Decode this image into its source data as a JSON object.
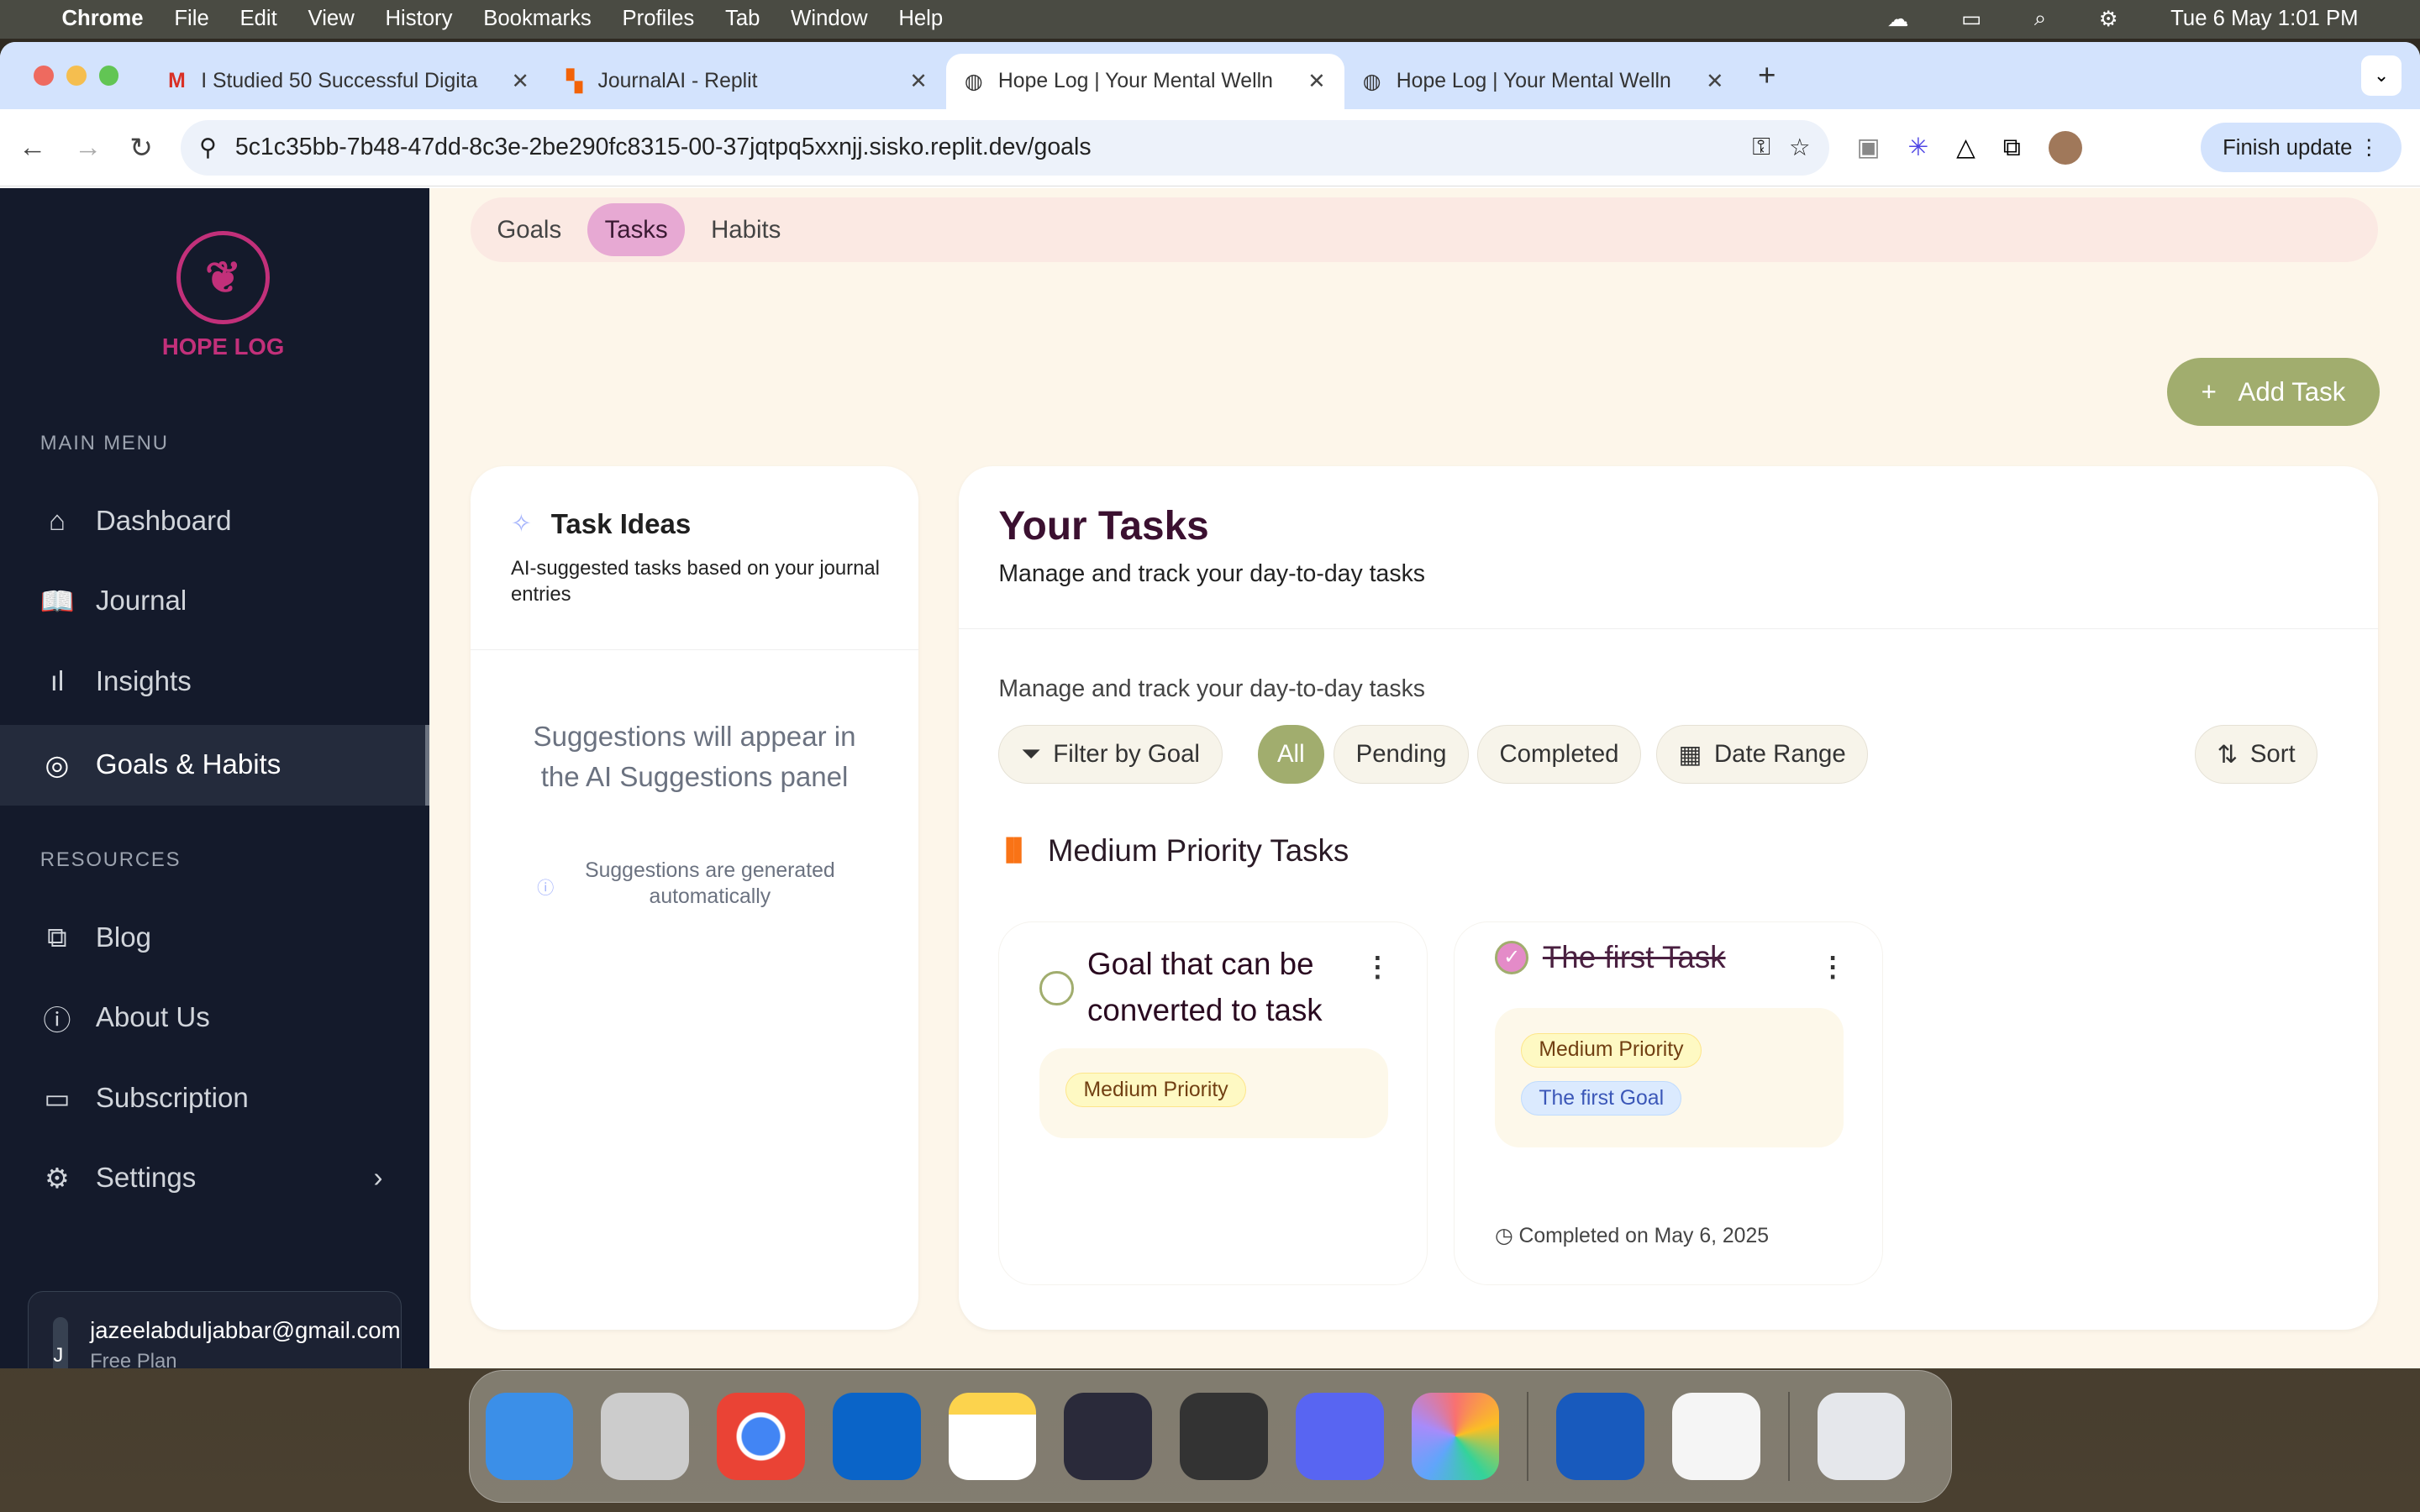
{
  "menubar": {
    "app": "Chrome",
    "items": [
      "File",
      "Edit",
      "View",
      "History",
      "Bookmarks",
      "Profiles",
      "Tab",
      "Window",
      "Help"
    ],
    "datetime": "Tue 6 May  1:01 PM"
  },
  "browser": {
    "tabs": [
      {
        "title": "I Studied 50 Successful Digita",
        "icon": "gmail-icon"
      },
      {
        "title": "JournalAI - Replit",
        "icon": "replit-icon"
      },
      {
        "title": "Hope Log | Your Mental Welln",
        "icon": "globe-icon",
        "active": true
      },
      {
        "title": "Hope Log | Your Mental Welln",
        "icon": "globe-icon"
      }
    ],
    "url": "5c1c35bb-7b48-47dd-8c3e-2be290fc8315-00-37jqtpq5xxnjj.sisko.replit.dev/goals",
    "finish_update": "Finish update"
  },
  "sidebar": {
    "logo": "HOPE LOG",
    "main_menu": "MAIN MENU",
    "items": [
      {
        "label": "Dashboard",
        "icon": "home-icon"
      },
      {
        "label": "Journal",
        "icon": "book-icon"
      },
      {
        "label": "Insights",
        "icon": "bar-chart-icon"
      },
      {
        "label": "Goals & Habits",
        "icon": "target-icon",
        "active": true
      }
    ],
    "resources": "RESOURCES",
    "resource_items": [
      {
        "label": "Blog",
        "icon": "external-link-icon"
      },
      {
        "label": "About Us",
        "icon": "info-icon"
      },
      {
        "label": "Subscription",
        "icon": "credit-card-icon"
      },
      {
        "label": "Settings",
        "icon": "gear-icon"
      }
    ],
    "user": {
      "initial": "J",
      "email": "jazeelabduljabbar@gmail.com",
      "plan": "Free Plan"
    }
  },
  "subtabs": [
    "Goals",
    "Tasks",
    "Habits"
  ],
  "active_subtab": "Tasks",
  "add_task": "Add Task",
  "ideas": {
    "title": "Task Ideas",
    "desc": "AI-suggested tasks based on your journal entries",
    "empty": "Suggestions will appear in the AI Suggestions panel",
    "note": "Suggestions are generated automatically"
  },
  "tasks": {
    "title": "Your Tasks",
    "subtitle": "Manage and track your day-to-day tasks",
    "subtitle2": "Manage and track your day-to-day tasks",
    "filters": {
      "filter_goal": "Filter by Goal",
      "all": "All",
      "pending": "Pending",
      "completed": "Completed",
      "date_range": "Date Range",
      "sort": "Sort"
    },
    "active_filter": "All",
    "group": "Medium Priority Tasks",
    "items": [
      {
        "title": "Goal that can be converted to task",
        "completed": false,
        "priority": "Medium Priority"
      },
      {
        "title": "The first Task",
        "completed": true,
        "priority": "Medium Priority",
        "goal": "The first Goal",
        "completed_on": "Completed on May 6, 2025"
      }
    ]
  },
  "colors": {
    "accent": "#a1ad6e",
    "brand": "#c2307a",
    "sidebar": "#141a2b",
    "background": "#fdf6ea"
  }
}
